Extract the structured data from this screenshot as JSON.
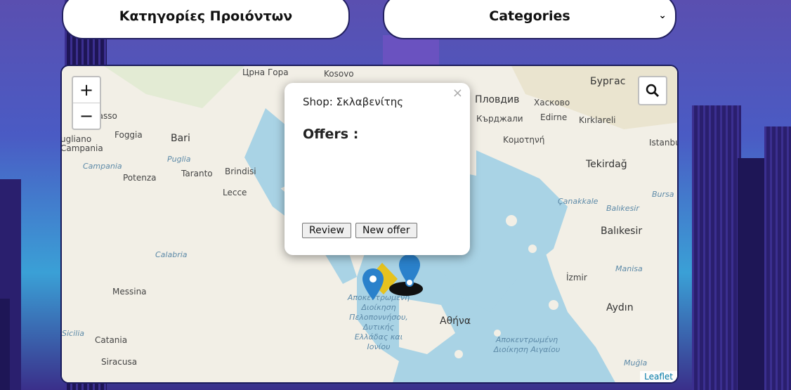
{
  "header": {
    "category_label": "Κατηγορίες Προιόντων",
    "category_select_value": "Categories"
  },
  "map": {
    "zoom_in": "+",
    "zoom_out": "−",
    "attribution": "Leaflet",
    "labels": {
      "crna_gora": "Црна Гора",
      "kosovo": "Kosovo",
      "burgas": "Бургас",
      "plovdiv": "Пловдив",
      "haskovo": "Хасково",
      "kardzhali": "Кърджали",
      "edirne": "Edirne",
      "kirklareli": "Kırklareli",
      "komotini": "Κομοτηνή",
      "istanbul": "Istanbul",
      "tekirdag": "Tekirdağ",
      "bari": "Bari",
      "foggia": "Foggia",
      "puglia": "Puglia",
      "taranto": "Taranto",
      "brindisi": "Brindisi",
      "lecce": "Lecce",
      "potenza": "Potenza",
      "campania": "Campania",
      "calabria": "Calabria",
      "messina": "Messina",
      "catania": "Catania",
      "siracusa": "Siracusa",
      "sicilia": "Sicilia",
      "canakkale": "Çanakkale",
      "balikesir1": "Balıkesir",
      "balikesir2": "Balıkesir",
      "manisa": "Manisa",
      "izmir": "İzmir",
      "aydin": "Aydın",
      "athina": "Αθήνα",
      "peloponnisos": "Αποκεντρωμένη Διοίκηση Πελοποννήσου, Δυτικής Ελλάδας και Ιονίου",
      "aigaiou": "Αποκεντρωμένη Διοίκηση Αιγαίου",
      "mugla": "Muğla",
      "bursa": "Bursa",
      "basso": "basso",
      "ugliano": "ugliano"
    }
  },
  "popup": {
    "close": "×",
    "shop": "Shop: Σκλαβενίτης",
    "offers_label": "Offers :",
    "review_button": "Review",
    "new_offer_button": "New offer"
  },
  "colors": {
    "marker_blue": "#2a81cb",
    "marker_yellow": "#e6c21e"
  }
}
